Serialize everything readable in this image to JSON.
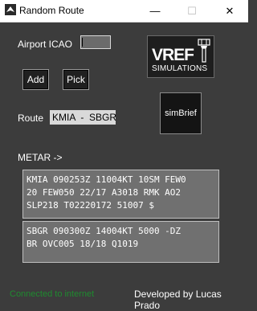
{
  "window": {
    "title": "Random Route",
    "minimize_glyph": "—",
    "maximize_glyph": "☐",
    "close_glyph": "✕"
  },
  "airport": {
    "label": "Airport ICAO",
    "value": ""
  },
  "buttons": {
    "add": "Add",
    "pick": "Pick"
  },
  "logo": {
    "line1": "VREF",
    "line2": "SIMULATIONS"
  },
  "simbrief": {
    "label": "simBrief"
  },
  "route": {
    "label": "Route",
    "value": "KMIA  -  SBGR"
  },
  "metar": {
    "label": "METAR ->",
    "reports": [
      [
        "KMIA 090253Z 11004KT 10SM FEW0",
        "20 FEW050 22/17 A3018 RMK AO2",
        "SLP218 T02220172 51007 $"
      ],
      [
        "SBGR 090300Z 14004KT 5000 -DZ",
        "BR OVC005 18/18 Q1019"
      ]
    ]
  },
  "status": {
    "connection": "Connected to internet",
    "credit": "Developed by Lucas Prado",
    "connection_color": "#1f8a2f"
  }
}
